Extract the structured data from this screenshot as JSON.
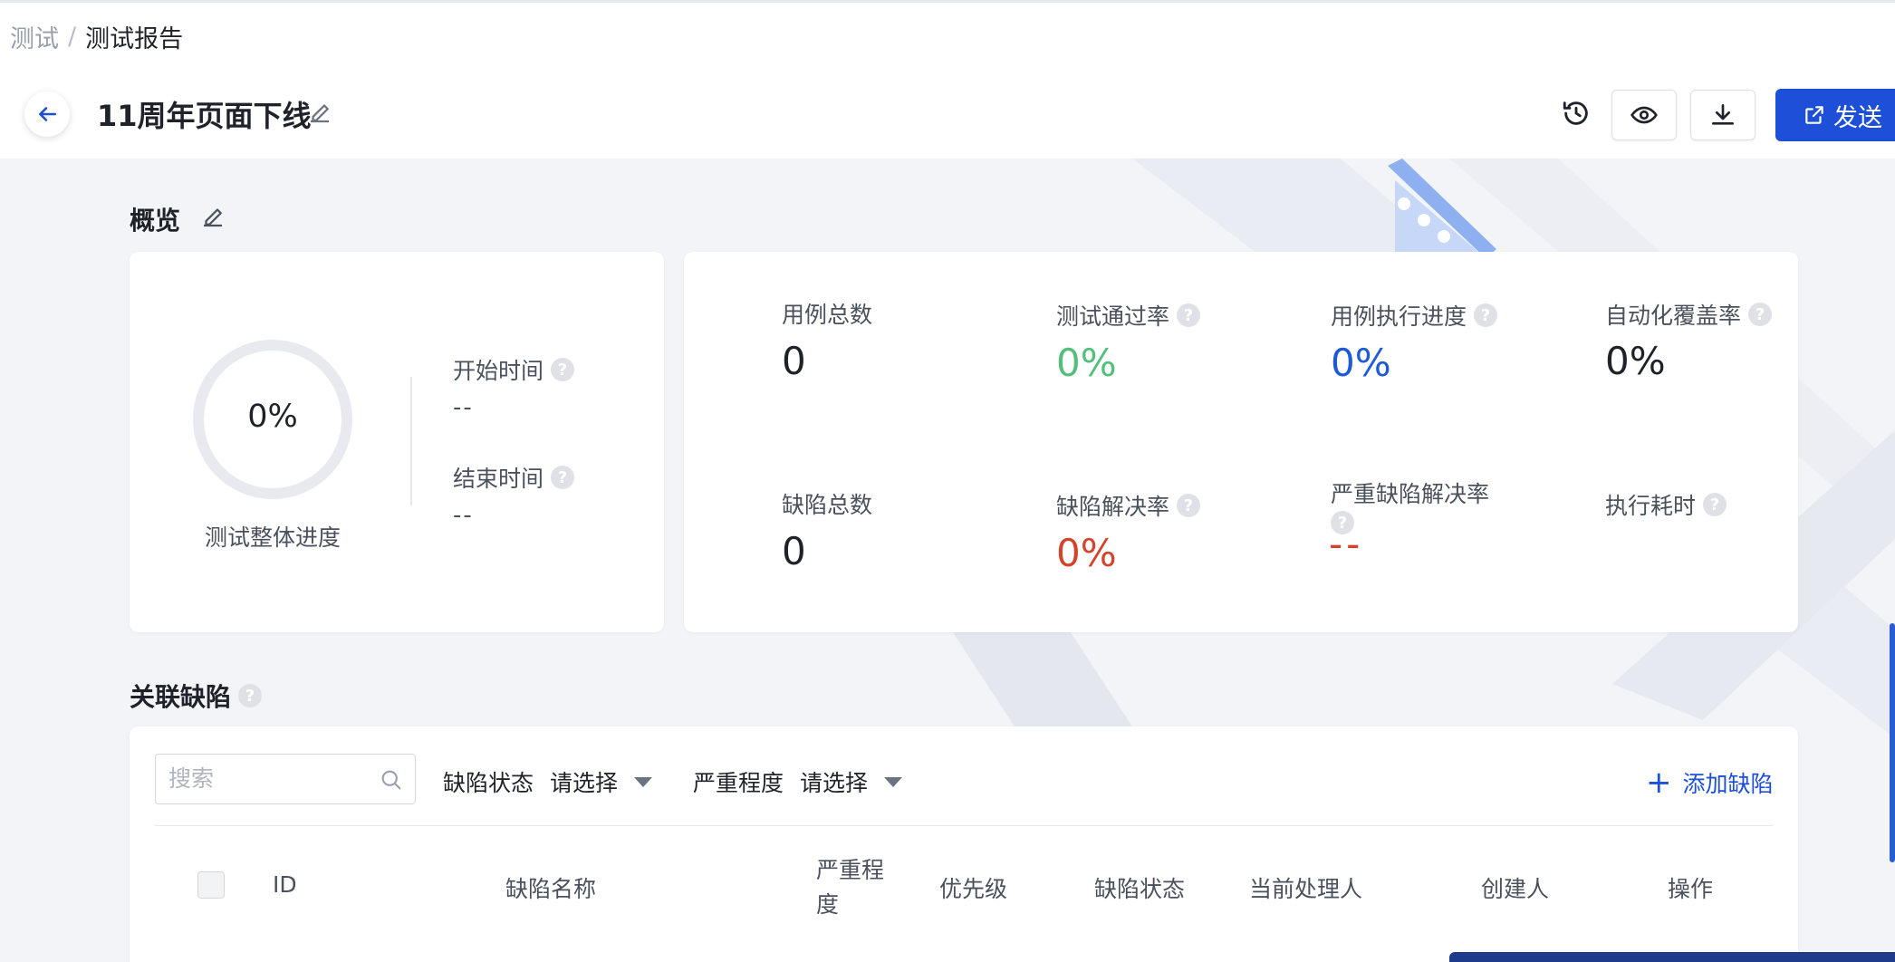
{
  "breadcrumb": {
    "root": "测试",
    "separator": "/",
    "current": "测试报告"
  },
  "header": {
    "title": "11周年页面下线",
    "send_label": "发送"
  },
  "overview": {
    "title": "概览",
    "progress_percent": "0%",
    "progress_caption": "测试整体进度",
    "start_time_label": "开始时间",
    "start_time_value": "--",
    "end_time_label": "结束时间",
    "end_time_value": "--",
    "help_mark": "?",
    "stats": {
      "total_cases": {
        "label": "用例总数",
        "value": "0"
      },
      "pass_rate": {
        "label": "测试通过率",
        "value": "0%"
      },
      "exec_progress": {
        "label": "用例执行进度",
        "value": "0%"
      },
      "auto_coverage": {
        "label": "自动化覆盖率",
        "value": "0%"
      },
      "total_defects": {
        "label": "缺陷总数",
        "value": "0"
      },
      "resolve_rate": {
        "label": "缺陷解决率",
        "value": "0%"
      },
      "severe_resolve_rate": {
        "label": "严重缺陷解决率",
        "value": "--"
      },
      "exec_duration": {
        "label": "执行耗时",
        "value": ""
      }
    }
  },
  "defects": {
    "title": "关联缺陷",
    "search_placeholder": "搜索",
    "filter_status_label": "缺陷状态",
    "filter_status_value": "请选择",
    "filter_severity_label": "严重程度",
    "filter_severity_value": "请选择",
    "add_label": "添加缺陷",
    "columns": [
      "ID",
      "缺陷名称",
      "严重程度",
      "优先级",
      "缺陷状态",
      "当前处理人",
      "创建人",
      "操作"
    ]
  },
  "colors": {
    "accent": "#1d4fd8",
    "pass_green": "#52c07a",
    "progress_blue": "#1d5ad6",
    "defect_red": "#d4432c"
  },
  "icons": [
    "back-arrow-icon",
    "edit-pencil-icon",
    "history-icon",
    "eye-icon",
    "download-icon",
    "external-link-icon",
    "help-circle-icon",
    "search-icon",
    "caret-down-icon",
    "plus-icon"
  ]
}
